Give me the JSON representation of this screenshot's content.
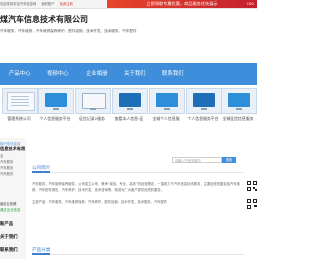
{
  "topbar": {
    "links": [
      "欢迎来到本站汽车信息网",
      "我的账户",
      "免费注册"
    ],
    "promo": "立即领取专属优惠，商品服务优先展示",
    "promo_end": "coo"
  },
  "company": {
    "title": "煤汽车信息技术有限公司",
    "keywords": "汽车服务，汽车维修，汽车维修保养养护，配件经销，技术开发，技术服务，汽车配件"
  },
  "nav": {
    "items": [
      "产品中心",
      "视频中心",
      "企业相册",
      "关于我们",
      "联系我们"
    ]
  },
  "products": [
    {
      "label": "管理系统公司",
      "style": "card"
    },
    {
      "label": "个人信息服务平台",
      "style": "blue"
    },
    {
      "label": "征信记录2服务",
      "style": "white"
    },
    {
      "label": "查看本人信息-征",
      "style": "dark"
    },
    {
      "label": "全城个人信息服",
      "style": "blue"
    },
    {
      "label": "个人信息服务平台",
      "style": "dark"
    },
    {
      "label": "全城征信信息服务",
      "style": "blue"
    }
  ],
  "sidebar": {
    "caption": "煤汽车信息技",
    "heading": "信息技术有限",
    "lines": [
      "名",
      "汽车服务",
      "汽车服务",
      "汽车服务"
    ],
    "subheading": "景区业执照",
    "green_tag": "通过企业信息",
    "bold_lines": [
      "新产品",
      "关于我们",
      "联系我们"
    ]
  },
  "main": {
    "intro_heading": "公司简介",
    "search_placeholder": "请输入产品关键词",
    "search_button": "搜索",
    "intro_text": "汽车服务，汽车维修保养服务，公司成立以来，秉承“诚信、专业、高效”的经营理念，一直致力于汽车信息技术服务，主要经营范围包括汽车维修、汽车配件销售、汽车养护、技术开发、技术咨询等，竭诚为广大客户提供优质的服务。",
    "scope_text": "主营产品：汽车服务，汽车维修保养，汽车养护，配件经销，技术开发，技术服务，汽车配件",
    "products_heading": "产品分类"
  }
}
